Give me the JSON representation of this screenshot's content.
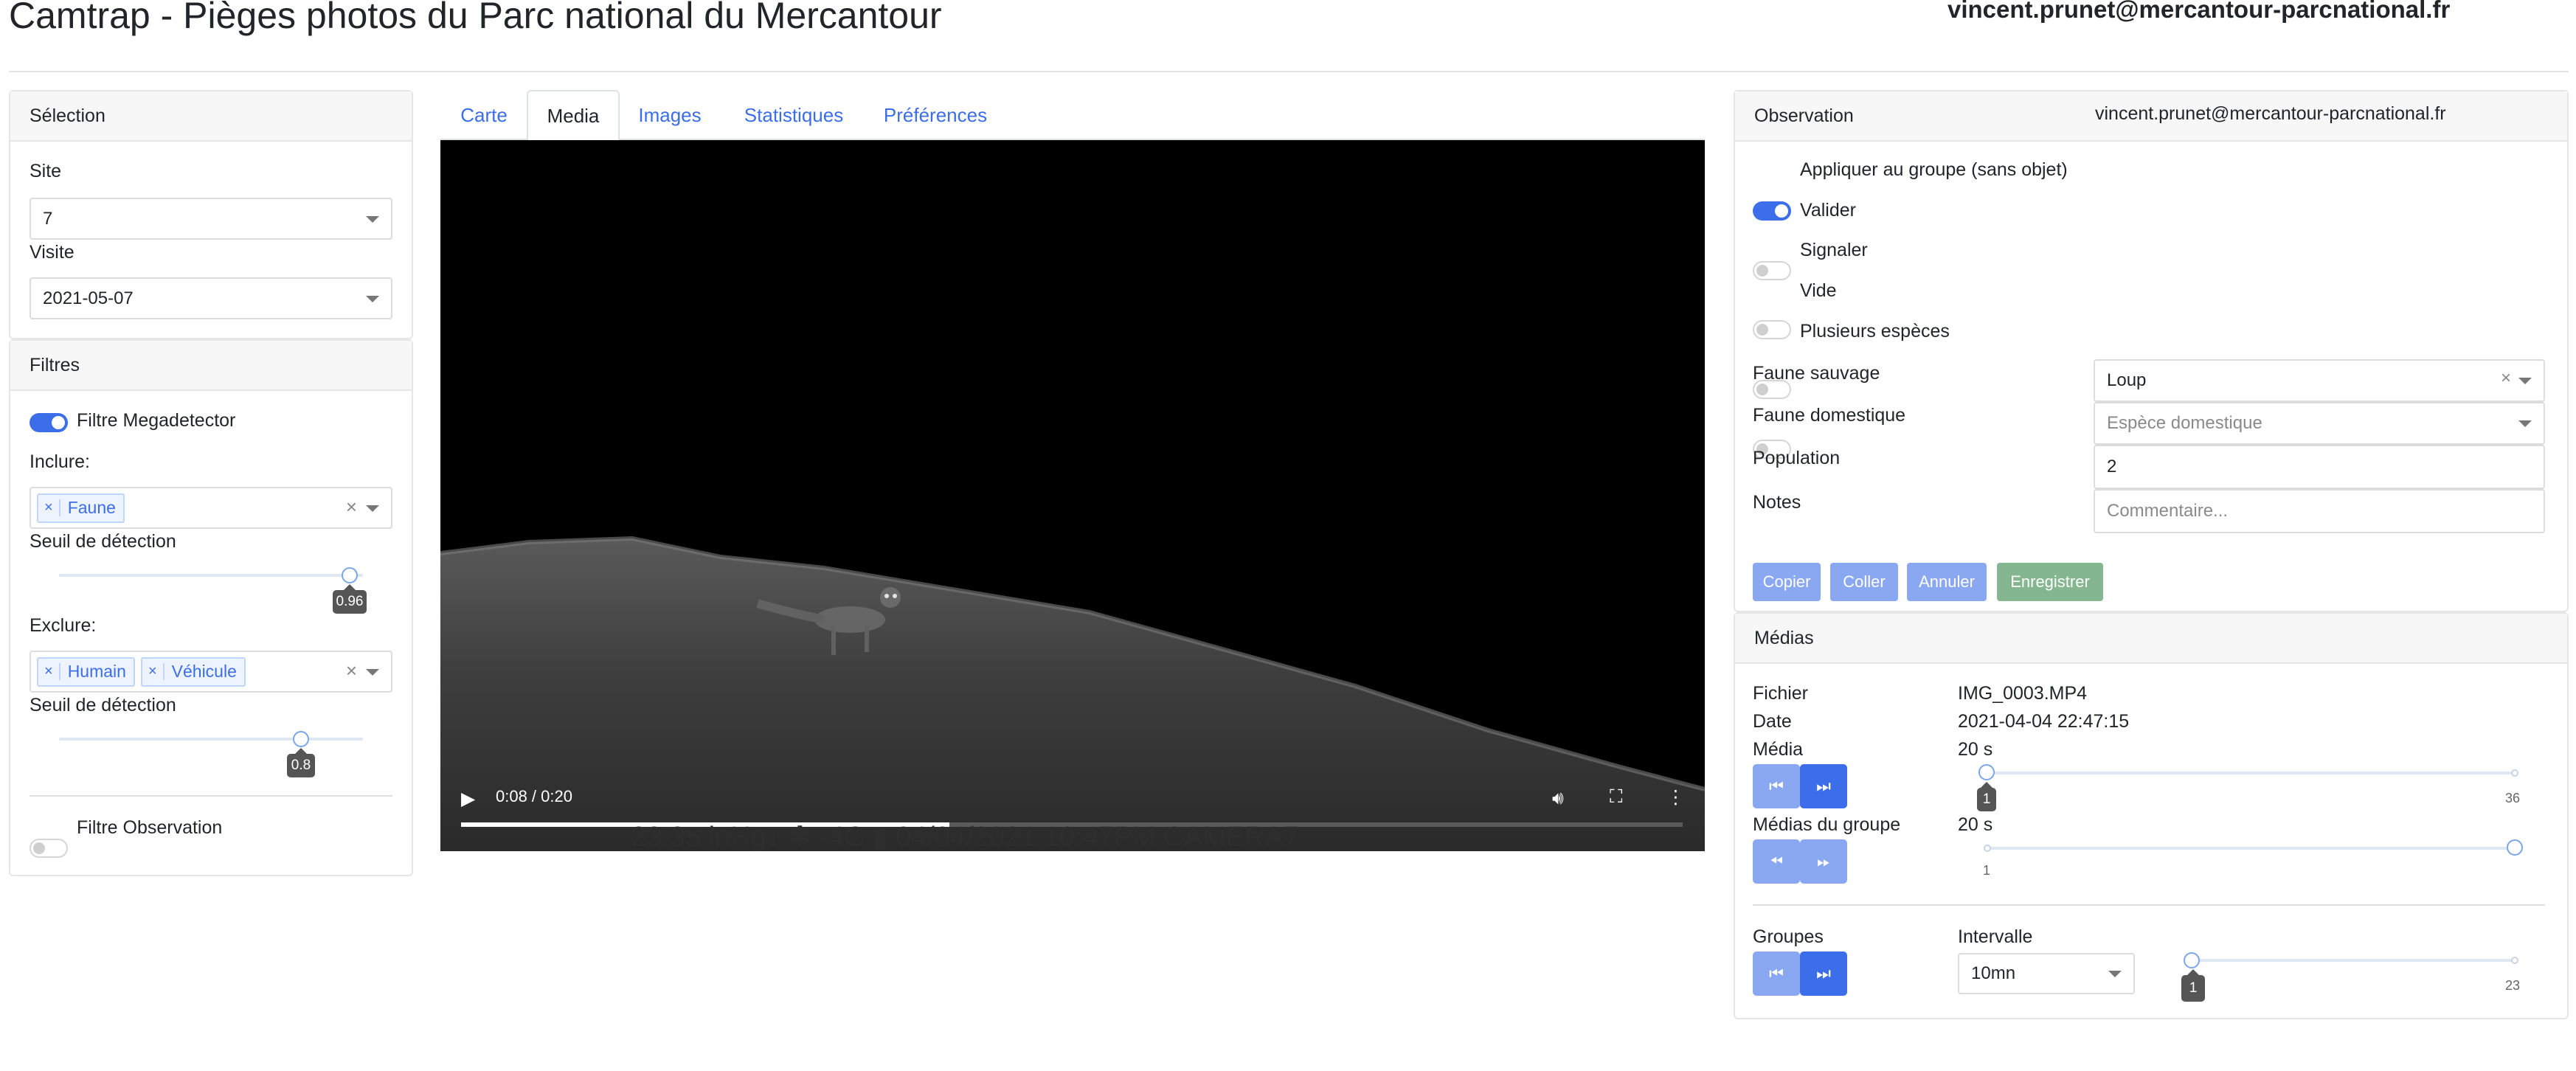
{
  "header": {
    "title": "Camtrap - Pièges photos du Parc national du Mercantour",
    "user": "vincent.prunet@mercantour-parcnational.fr"
  },
  "selection": {
    "heading": "Sélection",
    "site_label": "Site",
    "site_value": "7",
    "visit_label": "Visite",
    "visit_value": "2021-05-07"
  },
  "filters": {
    "heading": "Filtres",
    "megadetector_label": "Filtre Megadetector",
    "megadetector_on": true,
    "include_label": "Inclure:",
    "include_tags": [
      "Faune"
    ],
    "include_threshold_label": "Seuil de détection",
    "include_threshold": 0.96,
    "exclude_label": "Exclure:",
    "exclude_tags": [
      "Humain",
      "Véhicule"
    ],
    "exclude_threshold_label": "Seuil de détection",
    "exclude_threshold": 0.8,
    "observation_label": "Filtre Observation",
    "observation_on": false
  },
  "tabs": [
    "Carte",
    "Media",
    "Images",
    "Statistiques",
    "Préférences"
  ],
  "active_tab": "Media",
  "video": {
    "time": "0:08 / 0:20",
    "current_seconds": 8,
    "duration_seconds": 20,
    "overlay": "23.35  inHg↓   ✱ -4C   ▮   04/04/2021   10:47PM   CAMERA7"
  },
  "observation": {
    "heading": "Observation",
    "user": "vincent.prunet@mercantour-parcnational.fr",
    "toggles": [
      {
        "label": "Appliquer au groupe (sans objet)",
        "on": true
      },
      {
        "label": "Valider",
        "on": false
      },
      {
        "label": "Signaler",
        "on": false
      },
      {
        "label": "Vide",
        "on": false
      },
      {
        "label": "Plusieurs espèces",
        "on": false
      }
    ],
    "wild_label": "Faune sauvage",
    "wild_value": "Loup",
    "domestic_label": "Faune domestique",
    "domestic_placeholder": "Espèce domestique",
    "population_label": "Population",
    "population_value": "2",
    "notes_label": "Notes",
    "notes_placeholder": "Commentaire...",
    "buttons": {
      "copy": "Copier",
      "paste": "Coller",
      "cancel": "Annuler",
      "save": "Enregistrer"
    }
  },
  "medias": {
    "heading": "Médias",
    "file_label": "Fichier",
    "file_value": "IMG_0003.MP4",
    "date_label": "Date",
    "date_value": "2021-04-04 22:47:15",
    "media_label": "Média",
    "media_value": "20 s",
    "media_index": 1,
    "media_min": "1",
    "media_max": "36",
    "group_media_label": "Médias du groupe",
    "group_media_value": "20 s",
    "group_min": "1",
    "groups_label": "Groupes",
    "interval_label": "Intervalle",
    "interval_value": "10mn",
    "groups_index": 1,
    "groups_min": "1",
    "groups_max": "23"
  },
  "colors": {
    "accent": "#3b6ee8",
    "accent_light": "#8aa8f2",
    "save_green": "#84b68f"
  }
}
